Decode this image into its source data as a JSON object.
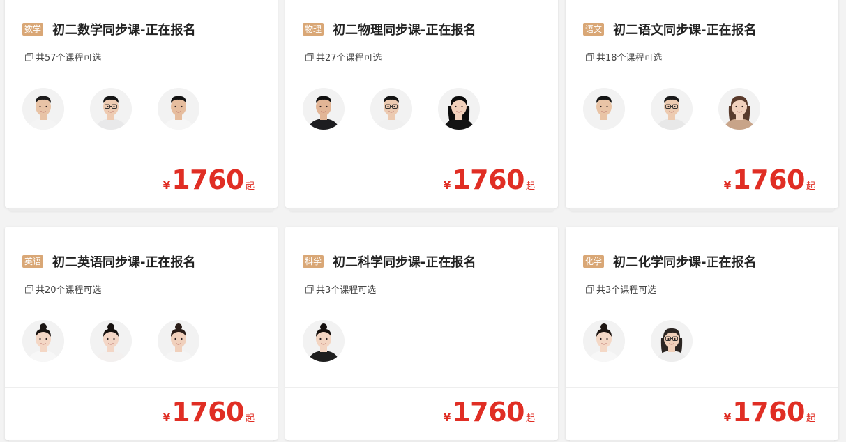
{
  "currency_symbol": "¥",
  "price_suffix": "起",
  "colors": {
    "tag_bg": "#d9a776",
    "price": "#e02e24"
  },
  "cards": [
    {
      "tag": "数学",
      "title": "初二数学同步课-正在报名",
      "count": "共57个课程可选",
      "price": "1760",
      "avatars": [
        {
          "skin": "#e8c3a6",
          "hair": "#1c1b1b",
          "shirt": "#f4f4f4",
          "hair_style": "short",
          "glasses": false
        },
        {
          "skin": "#eecbb2",
          "hair": "#151515",
          "shirt": "#e9e9ea",
          "hair_style": "short",
          "glasses": true
        },
        {
          "skin": "#e6bd9e",
          "hair": "#111111",
          "shirt": "#f6f6f6",
          "hair_style": "short",
          "glasses": false
        }
      ]
    },
    {
      "tag": "物理",
      "title": "初二物理同步课-正在报名",
      "count": "共27个课程可选",
      "price": "1760",
      "avatars": [
        {
          "skin": "#e2b596",
          "hair": "#0f0f0f",
          "shirt": "#1d1d20",
          "hair_style": "short",
          "glasses": false
        },
        {
          "skin": "#eccab1",
          "hair": "#141414",
          "shirt": "#f0f0f0",
          "hair_style": "short",
          "glasses": true
        },
        {
          "skin": "#f1d0bb",
          "hair": "#0c0c0c",
          "shirt": "#141414",
          "hair_style": "long",
          "glasses": false
        }
      ]
    },
    {
      "tag": "语文",
      "title": "初二语文同步课-正在报名",
      "count": "共18个课程可选",
      "price": "1760",
      "avatars": [
        {
          "skin": "#e9c4a6",
          "hair": "#131313",
          "shirt": "#f2f2f2",
          "hair_style": "short",
          "glasses": false
        },
        {
          "skin": "#edcbb1",
          "hair": "#1a1a1a",
          "shirt": "#e8e8e8",
          "hair_style": "short",
          "glasses": true
        },
        {
          "skin": "#f2d1bd",
          "hair": "#5a3b2c",
          "shirt": "#c8a489",
          "hair_style": "long",
          "glasses": false
        }
      ]
    },
    {
      "tag": "英语",
      "title": "初二英语同步课-正在报名",
      "count": "共20个课程可选",
      "price": "1760",
      "avatars": [
        {
          "skin": "#f4d7c5",
          "hair": "#1a1412",
          "shirt": "#f7f7f7",
          "hair_style": "bun",
          "glasses": false
        },
        {
          "skin": "#f3d6c6",
          "hair": "#16110f",
          "shirt": "#f3f0ef",
          "hair_style": "bun",
          "glasses": false
        },
        {
          "skin": "#f0d0bc",
          "hair": "#2a1d18",
          "shirt": "#f5f5f5",
          "hair_style": "bun",
          "glasses": false
        }
      ]
    },
    {
      "tag": "科学",
      "title": "初二科学同步课-正在报名",
      "count": "共3个课程可选",
      "price": "1760",
      "avatars": [
        {
          "skin": "#f3d5c2",
          "hair": "#15100e",
          "shirt": "#1e1e1e",
          "hair_style": "bun",
          "glasses": false
        }
      ]
    },
    {
      "tag": "化学",
      "title": "初二化学同步课-正在报名",
      "count": "共3个课程可选",
      "price": "1760",
      "avatars": [
        {
          "skin": "#f4d8c6",
          "hair": "#1d1512",
          "shirt": "#f7f7f7",
          "hair_style": "bun",
          "glasses": false
        },
        {
          "skin": "#f0d0ba",
          "hair": "#2b2522",
          "shirt": "#ededed",
          "hair_style": "long",
          "glasses": true
        }
      ]
    }
  ]
}
